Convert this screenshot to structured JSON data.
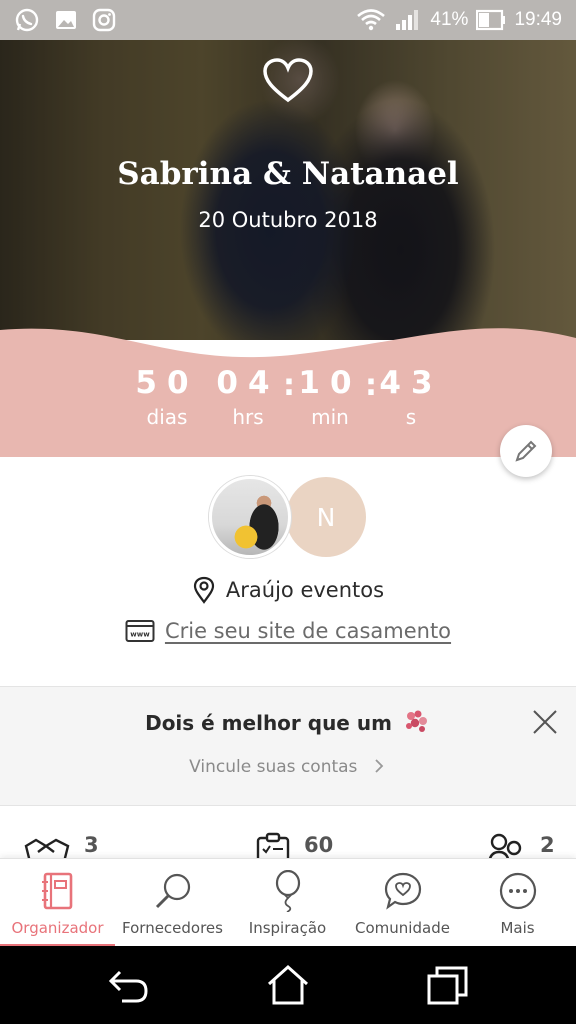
{
  "status_bar": {
    "battery": "41%",
    "time": "19:49",
    "icons": [
      "whatsapp-icon",
      "gallery-icon",
      "instagram-icon",
      "wifi-icon",
      "signal-icon",
      "battery-icon"
    ]
  },
  "hero": {
    "couple_names": "Sabrina & Natanael",
    "date": "20 Outubro 2018"
  },
  "countdown": {
    "days": "50",
    "days_label": "dias",
    "hours": "04",
    "hours_label": "hrs",
    "minutes": "10",
    "minutes_label": "min",
    "seconds": "43",
    "seconds_label": "s",
    "separator": ":"
  },
  "profile": {
    "partner_initial": "N",
    "vendor": "Araújo eventos",
    "site_link": "Crie seu site de casamento"
  },
  "link_card": {
    "title": "Dois é melhor que um",
    "subtitle": "Vincule suas contas"
  },
  "stats": [
    {
      "icon": "handshake-icon",
      "value": "3"
    },
    {
      "icon": "checklist-icon",
      "value": "60"
    },
    {
      "icon": "guests-icon",
      "value": "2"
    }
  ],
  "bottom_nav": [
    {
      "label": "Organizador",
      "icon": "planner-icon",
      "active": true
    },
    {
      "label": "Fornecedores",
      "icon": "search-icon",
      "active": false
    },
    {
      "label": "Inspiração",
      "icon": "balloon-icon",
      "active": false
    },
    {
      "label": "Comunidade",
      "icon": "chat-heart-icon",
      "active": false
    },
    {
      "label": "Mais",
      "icon": "more-icon",
      "active": false
    }
  ],
  "colors": {
    "accent": "#e8737a",
    "countdown_bg": "#e8b7b0",
    "initial_avatar": "#ead4c3"
  }
}
